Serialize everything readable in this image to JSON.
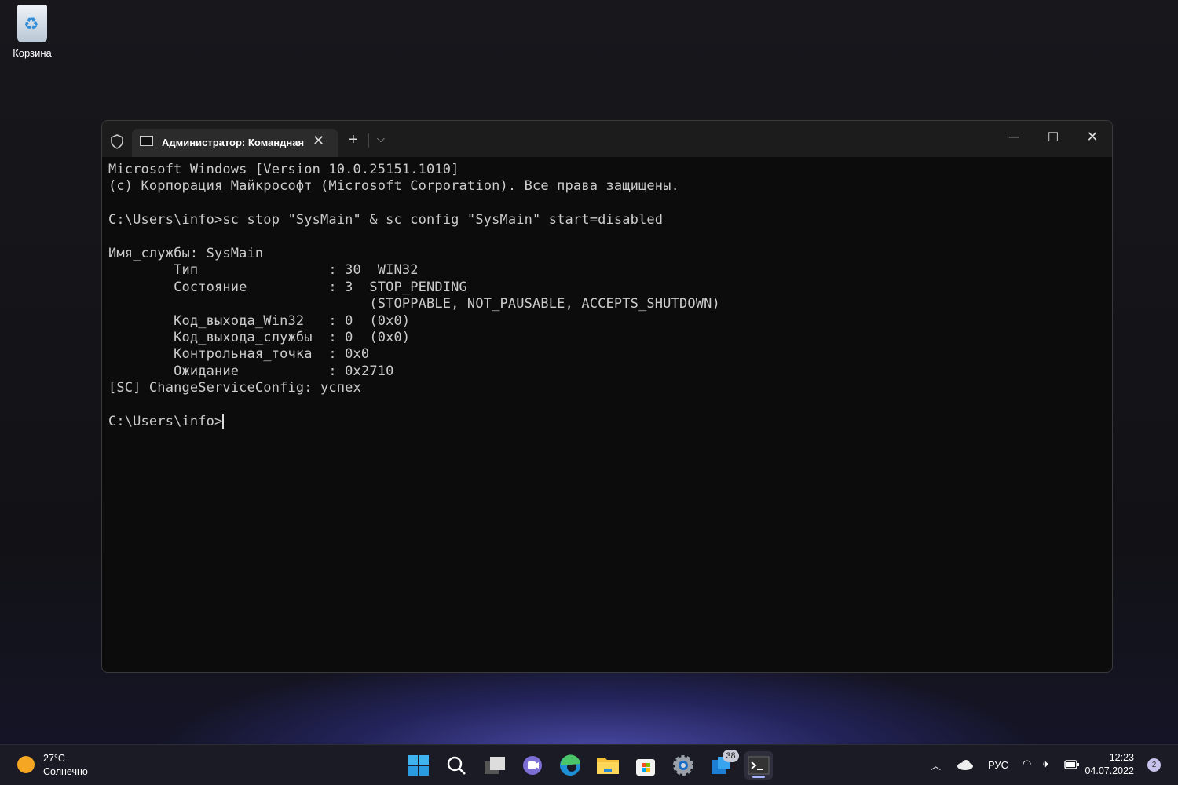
{
  "desktop": {
    "recycle_bin_label": "Корзина"
  },
  "window": {
    "tab_title": "Администратор: Командная строка",
    "terminal_lines": [
      "Microsoft Windows [Version 10.0.25151.1010]",
      "(c) Корпорация Майкрософт (Microsoft Corporation). Все права защищены.",
      "",
      "C:\\Users\\info>sc stop \"SysMain\" & sc config \"SysMain\" start=disabled",
      "",
      "Имя_службы: SysMain",
      "        Тип                : 30  WIN32",
      "        Состояние          : 3  STOP_PENDING",
      "                                (STOPPABLE, NOT_PAUSABLE, ACCEPTS_SHUTDOWN)",
      "        Код_выхода_Win32   : 0  (0x0)",
      "        Код_выхода_службы  : 0  (0x0)",
      "        Контрольная_точка  : 0x0",
      "        Ожидание           : 0x2710",
      "[SC] ChangeServiceConfig: успех",
      ""
    ],
    "prompt": "C:\\Users\\info>"
  },
  "taskbar": {
    "weather_temp": "27°C",
    "weather_desc": "Солнечно",
    "apps": [
      "start",
      "search",
      "task-view",
      "teams-chat",
      "edge",
      "file-explorer",
      "store",
      "settings",
      "widgets",
      "terminal"
    ],
    "widgets_badge": "38",
    "language": "РУС",
    "time": "12:23",
    "date": "04.07.2022",
    "notifications": "2"
  }
}
